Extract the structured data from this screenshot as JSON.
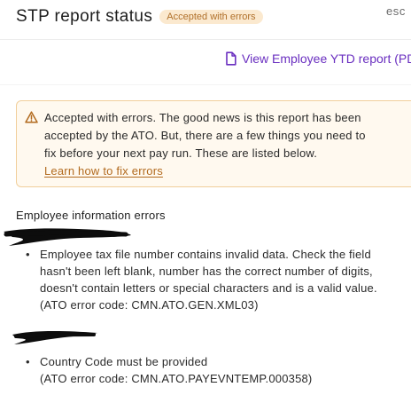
{
  "header": {
    "title": "STP report status",
    "status_badge": "Accepted with errors",
    "esc_label": "esc"
  },
  "ytd_link": {
    "label": "View Employee YTD report (PD",
    "icon": "document-icon"
  },
  "alert": {
    "icon": "warning-icon",
    "lines": [
      "Accepted with errors. The good news is this report has been",
      "accepted by the ATO. But, there are a few things you need to",
      "fix before your next pay run. These are listed below."
    ],
    "link_label": "Learn how to fix errors"
  },
  "employee_errors": {
    "title": "Employee information errors",
    "groups": [
      {
        "lines": [
          "Employee tax file number contains invalid data. Check the field",
          "hasn't been left blank, number has the correct number of digits,",
          "doesn't contain letters or special characters and is a valid value."
        ],
        "code": "(ATO error code: CMN.ATO.GEN.XML03)"
      },
      {
        "lines": [
          "Country Code must be provided"
        ],
        "code": "(ATO error code: CMN.ATO.PAYEVNTEMP.000358)"
      }
    ]
  },
  "colors": {
    "accent": "#6a2fc0",
    "badge_bg": "#fbe9cf",
    "badge_text": "#b0702a",
    "alert_bg": "#fff9ef",
    "alert_border": "#f1cf9b"
  }
}
